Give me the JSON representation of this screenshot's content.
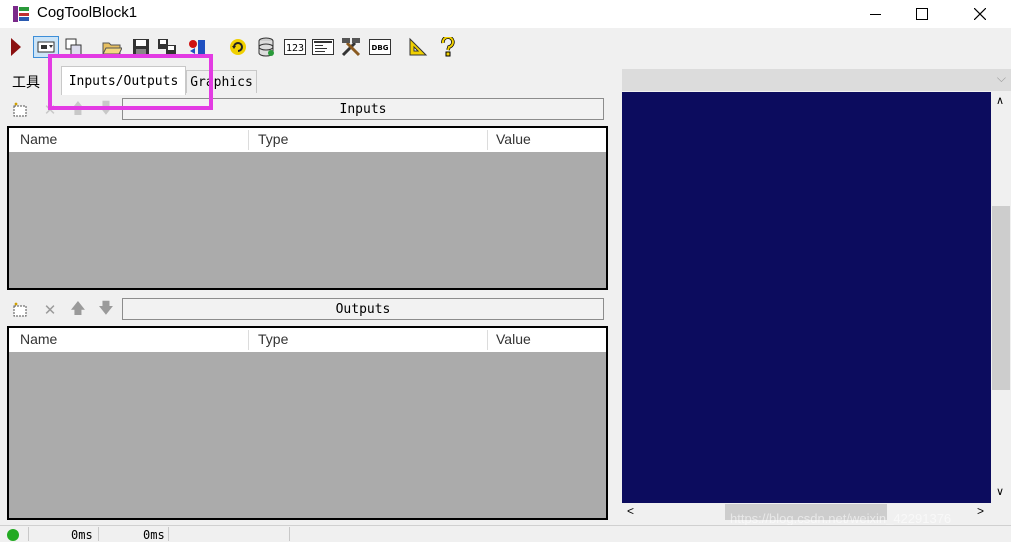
{
  "window": {
    "title": "CogToolBlock1",
    "minimize_icon": "minimize-icon",
    "maximize_icon": "maximize-icon",
    "close_icon": "close-icon"
  },
  "toolbar": {
    "icons": [
      "run-icon",
      "show-icon",
      "edit-icon",
      "open-icon",
      "save-icon",
      "save-as-icon",
      "reset-icon",
      "refresh-icon",
      "database-icon",
      "numeric-icon",
      "form-icon",
      "tools-icon",
      "debug-icon",
      "ruler-icon",
      "help-icon"
    ],
    "debug_label": "DBG",
    "numeric_label": "123"
  },
  "tabs": [
    {
      "label": "工具"
    },
    {
      "label": "Inputs/Outputs",
      "active": true
    },
    {
      "label": "Graphics"
    }
  ],
  "inputs": {
    "header": "Inputs",
    "columns": [
      "Name",
      "Type",
      "Value"
    ],
    "rows": []
  },
  "outputs": {
    "header": "Outputs",
    "columns": [
      "Name",
      "Type",
      "Value"
    ],
    "rows": []
  },
  "statusbar": {
    "time1": "0ms",
    "time2": "0ms",
    "status_color": "#22aa22"
  },
  "watermark": "https://blog.csdn.net/weixin_42291376",
  "colors": {
    "display_bg": "#0c0c5e",
    "highlight": "#e33be3"
  }
}
